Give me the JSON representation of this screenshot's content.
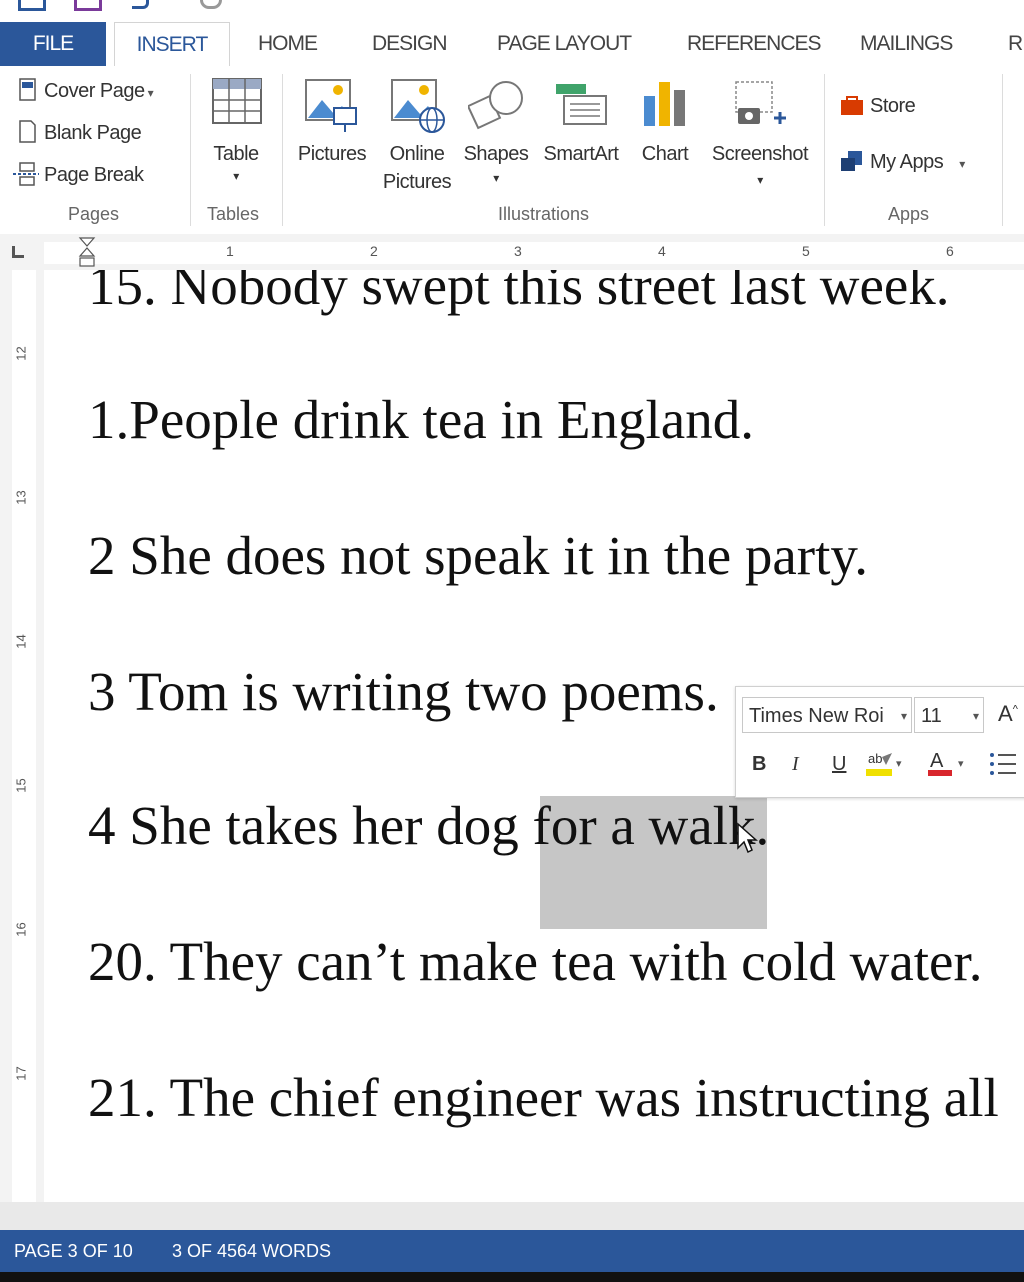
{
  "ribbon": {
    "tabs": [
      {
        "label": "FILE"
      },
      {
        "label": "INSERT"
      },
      {
        "label": "HOME"
      },
      {
        "label": "DESIGN"
      },
      {
        "label": "PAGE LAYOUT"
      },
      {
        "label": "REFERENCES"
      },
      {
        "label": "MAILINGS"
      },
      {
        "label": "R"
      }
    ],
    "pages": {
      "cover_page": "Cover Page",
      "blank_page": "Blank Page",
      "page_break": "Page Break",
      "group": "Pages"
    },
    "tables": {
      "table": "Table",
      "group": "Tables"
    },
    "illustrations": {
      "pictures": "Pictures",
      "online_pictures_1": "Online",
      "online_pictures_2": "Pictures",
      "shapes": "Shapes",
      "smartart": "SmartArt",
      "chart": "Chart",
      "screenshot": "Screenshot",
      "group": "Illustrations"
    },
    "apps": {
      "store": "Store",
      "my_apps": "My Apps",
      "group": "Apps"
    }
  },
  "ruler": {
    "numbers": [
      "1",
      "2",
      "3",
      "4",
      "5",
      "6"
    ],
    "vertical_numbers": [
      "12",
      "13",
      "14",
      "15",
      "16",
      "17"
    ]
  },
  "document": {
    "lines": [
      "15. Nobody swept this street last week.",
      "1.People drink tea in England.",
      "2 She does not speak it in the party.",
      "3 Tom is writing two poems.",
      "20. They can’t make tea with cold water.",
      "21. The chief engineer was instructing all"
    ],
    "line4_before": "4 She takes her dog ",
    "line4_selected": "for a walk",
    "line4_after": "."
  },
  "mini_toolbar": {
    "font_name": "Times New Roi",
    "font_size": "11",
    "bold": "B",
    "italic": "I",
    "underline": "U",
    "grow_font": "A"
  },
  "status": {
    "page": "PAGE 3 OF 10",
    "words": "3 OF 4564 WORDS"
  },
  "colors": {
    "accent": "#2b579a",
    "selection": "#c6c6c6",
    "highlight": "#f0e000",
    "font_color": "#d8262c"
  }
}
